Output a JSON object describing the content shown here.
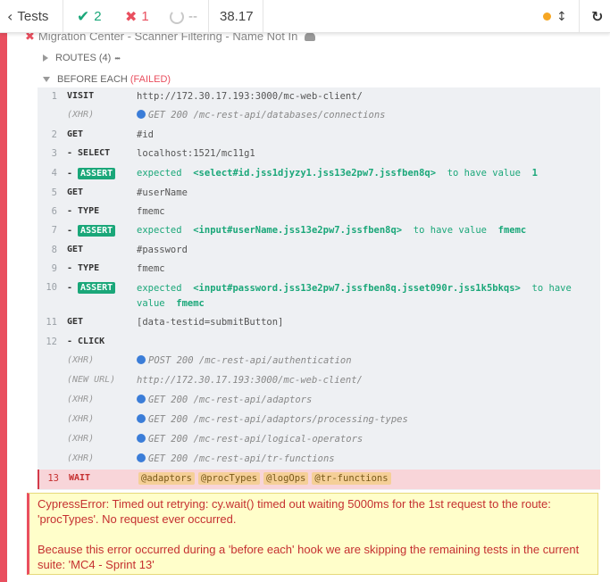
{
  "header": {
    "back_label": "Tests",
    "passed_count": "2",
    "failed_count": "1",
    "pending_count": "--",
    "duration": "38.17",
    "indicator_color": "#f6a623"
  },
  "test": {
    "title_clipped": "Migration Center - Scanner Filtering - Name Not In"
  },
  "routes": {
    "label": "ROUTES (4)",
    "more": "•••"
  },
  "hook": {
    "label": "BEFORE EACH",
    "status": "(FAILED)"
  },
  "commands": [
    {
      "num": "1",
      "name": "VISIT",
      "message": "http://172.30.17.193:3000/mc-web-client/"
    },
    {
      "num": "",
      "name": "(XHR)",
      "message": "GET 200 /mc-rest-api/databases/connections"
    },
    {
      "num": "2",
      "name": "GET",
      "message": "#id"
    },
    {
      "num": "3",
      "name": "- SELECT",
      "message": "localhost:1521/mc11g1"
    },
    {
      "num": "4",
      "name": "ASSERT",
      "prefix": "- ",
      "expected": "expected",
      "subject": "<select#id.jss1djyzy1.jss13e2pw7.jssfben8q>",
      "predicate": "to have value",
      "value": "1"
    },
    {
      "num": "5",
      "name": "GET",
      "message": "#userName"
    },
    {
      "num": "6",
      "name": "- TYPE",
      "message": "fmemc"
    },
    {
      "num": "7",
      "name": "ASSERT",
      "prefix": "- ",
      "expected": "expected",
      "subject": "<input#userName.jss13e2pw7.jssfben8q>",
      "predicate": "to have value",
      "value": "fmemc"
    },
    {
      "num": "8",
      "name": "GET",
      "message": "#password"
    },
    {
      "num": "9",
      "name": "- TYPE",
      "message": "fmemc"
    },
    {
      "num": "10",
      "name": "ASSERT",
      "prefix": "- ",
      "expected": "expected",
      "subject": "<input#password.jss13e2pw7.jssfben8q.jsset090r.jss1k5bkqs>",
      "predicate": "to have",
      "predicate2": "value",
      "value": "fmemc"
    },
    {
      "num": "11",
      "name": "GET",
      "message": "[data-testid=submitButton]"
    },
    {
      "num": "12",
      "name": "- CLICK",
      "message": ""
    },
    {
      "num": "",
      "name": "(XHR)",
      "message": "POST 200 /mc-rest-api/authentication"
    },
    {
      "num": "",
      "name": "(NEW URL)",
      "message": "http://172.30.17.193:3000/mc-web-client/"
    },
    {
      "num": "",
      "name": "(XHR)",
      "message": "GET 200 /mc-rest-api/adaptors"
    },
    {
      "num": "",
      "name": "(XHR)",
      "message": "GET 200 /mc-rest-api/adaptors/processing-types"
    },
    {
      "num": "",
      "name": "(XHR)",
      "message": "GET 200 /mc-rest-api/logical-operators"
    },
    {
      "num": "",
      "name": "(XHR)",
      "message": "GET 200 /mc-rest-api/tr-functions"
    },
    {
      "num": "13",
      "name": "WAIT",
      "aliases": [
        "@adaptors",
        "@procTypes",
        "@logOps",
        "@tr-functions"
      ]
    }
  ],
  "error": {
    "line1": "CypressError: Timed out retrying: cy.wait() timed out waiting 5000ms for the 1st request to the route: 'procTypes'. No request ever occurred.",
    "line2": "Because this error occurred during a 'before each' hook we are skipping the remaining tests in the current suite: 'MC4 - Sprint 13'"
  },
  "colors": {
    "failed": "#e94f5f",
    "passed": "#1aa779",
    "xhr_dot": "#3b7dd8",
    "alias_bg": "#f5cf97",
    "error_bg": "#fffeca"
  },
  "icons": [
    "chevron-left-icon",
    "check-icon",
    "x-icon",
    "pending-circle-icon",
    "status-dot-icon",
    "scroll-toggle-icon",
    "reload-icon",
    "x-icon",
    "user-icon",
    "triangle-right-icon",
    "triangle-down-icon",
    "ellipsis-icon"
  ]
}
